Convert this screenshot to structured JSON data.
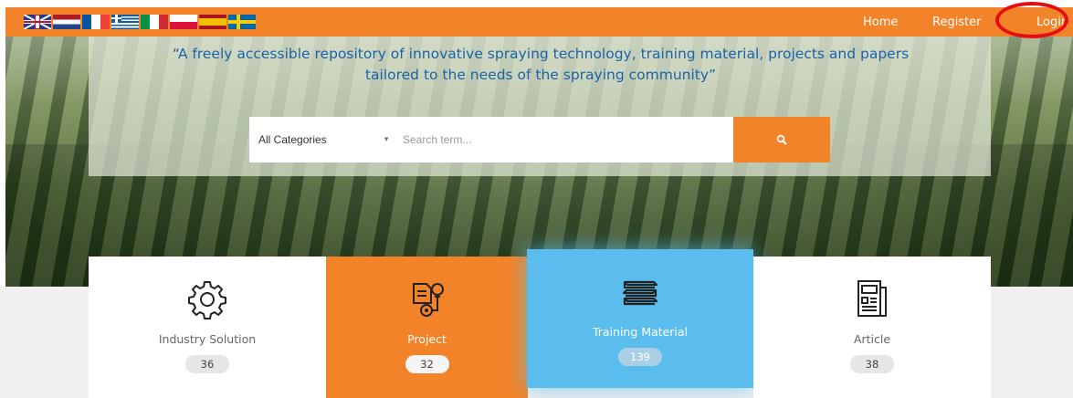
{
  "topbar": {
    "accent_color": "#f28328",
    "languages": [
      {
        "name": "English",
        "icon": "uk-flag-icon"
      },
      {
        "name": "Dutch",
        "icon": "netherlands-flag-icon"
      },
      {
        "name": "French",
        "icon": "france-flag-icon"
      },
      {
        "name": "Greek",
        "icon": "greece-flag-icon"
      },
      {
        "name": "Italian",
        "icon": "italy-flag-icon"
      },
      {
        "name": "Polish",
        "icon": "poland-flag-icon"
      },
      {
        "name": "Spanish",
        "icon": "spain-flag-icon"
      },
      {
        "name": "Swedish",
        "icon": "sweden-flag-icon"
      }
    ],
    "nav": {
      "home": "Home",
      "register": "Register",
      "login": "Login"
    },
    "highlight_color": "#e50d14"
  },
  "hero": {
    "tagline": "“A freely accessible repository of innovative spraying technology, training material, projects and papers tailored to the needs of the spraying community”"
  },
  "search": {
    "category_selected": "All Categories",
    "placeholder": "Search term...",
    "button_icon": "search-icon"
  },
  "categories": [
    {
      "label": "Industry Solution",
      "count": "36",
      "icon": "gear-icon"
    },
    {
      "label": "Project",
      "count": "32",
      "icon": "project-document-icon"
    },
    {
      "label": "Training Material",
      "count": "139",
      "icon": "books-icon"
    },
    {
      "label": "Article",
      "count": "38",
      "icon": "newspaper-icon"
    }
  ]
}
